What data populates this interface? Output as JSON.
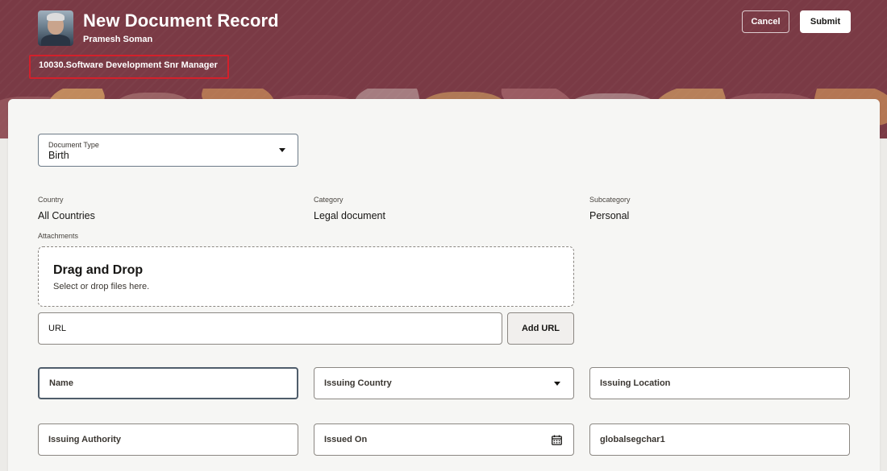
{
  "header": {
    "title": "New Document Record",
    "person_name": "Pramesh Soman",
    "assignment": "10030.Software Development Snr Manager",
    "cancel_label": "Cancel",
    "submit_label": "Submit",
    "brand_color": "#7a3a45"
  },
  "form": {
    "document_type": {
      "label": "Document Type",
      "value": "Birth"
    },
    "country": {
      "label": "Country",
      "value": "All Countries"
    },
    "category": {
      "label": "Category",
      "value": "Legal document"
    },
    "subcategory": {
      "label": "Subcategory",
      "value": "Personal"
    },
    "attachments": {
      "label": "Attachments",
      "drop_title": "Drag and Drop",
      "drop_subtitle": "Select or drop files here.",
      "url_label": "URL",
      "add_url_label": "Add URL"
    },
    "fields": {
      "name": "Name",
      "issuing_country": "Issuing Country",
      "issuing_location": "Issuing Location",
      "issuing_authority": "Issuing Authority",
      "issued_on": "Issued On",
      "global_seg": "globalsegchar1"
    }
  },
  "icons": {
    "document_type_dropdown": "chevron-down-icon",
    "issuing_country_dropdown": "chevron-down-icon",
    "issued_on_picker": "calendar-icon"
  }
}
